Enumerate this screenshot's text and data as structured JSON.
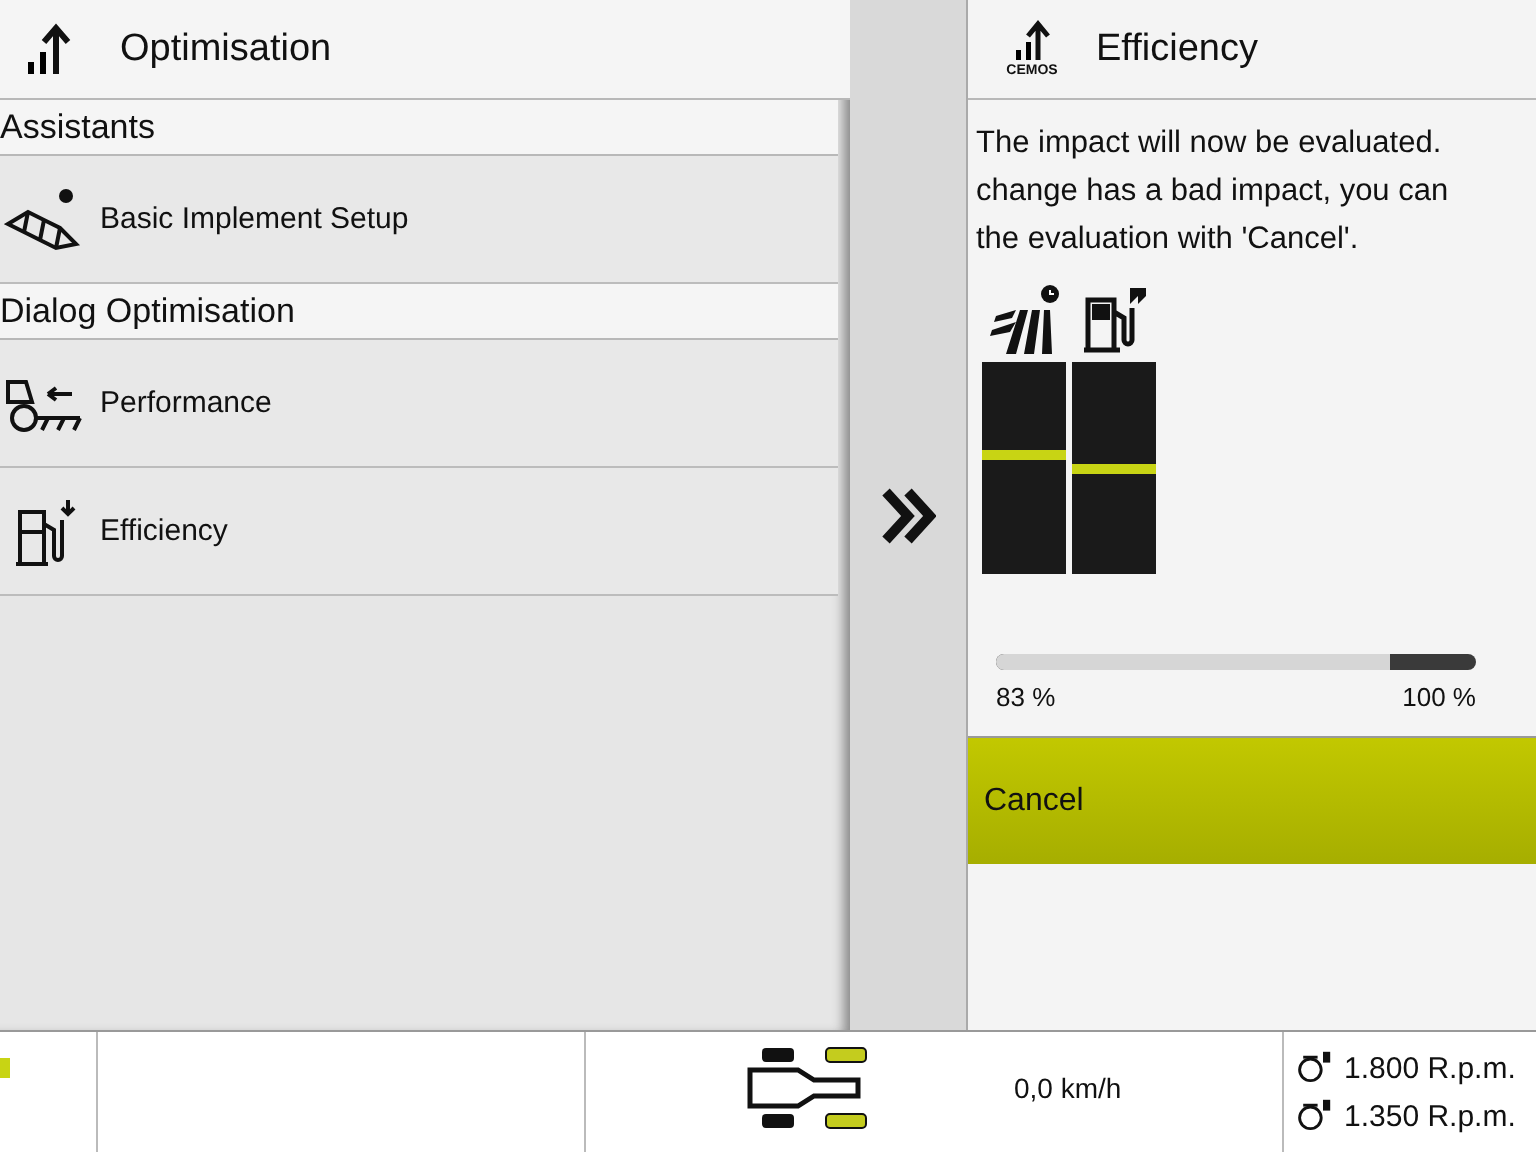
{
  "menu": {
    "title": "Optimisation",
    "sections": [
      {
        "title": "Assistants",
        "items": [
          {
            "label": "Basic Implement Setup",
            "kind": "implement"
          }
        ]
      },
      {
        "title": "Dialog Optimisation",
        "items": [
          {
            "label": "Performance",
            "kind": "tractor"
          },
          {
            "label": "Efficiency",
            "kind": "fuel"
          }
        ]
      }
    ]
  },
  "detail": {
    "title": "Efficiency",
    "logo_caption": "CEMOS",
    "message_lines": [
      "The impact will now be evaluated.",
      "change has a bad impact, you can",
      "the evaluation with 'Cancel'."
    ],
    "gauges": [
      {
        "kind": "field",
        "level": 0.54
      },
      {
        "kind": "fuel",
        "level": 0.47
      }
    ],
    "progress": {
      "level": 0.82,
      "min_label": "83 %",
      "max_label": "100 %"
    },
    "button": "Cancel"
  },
  "status_bar": {
    "speed": "0,0 km/h",
    "engine_speeds": [
      "1.800 R.p.m.",
      "1.350 R.p.m."
    ]
  }
}
